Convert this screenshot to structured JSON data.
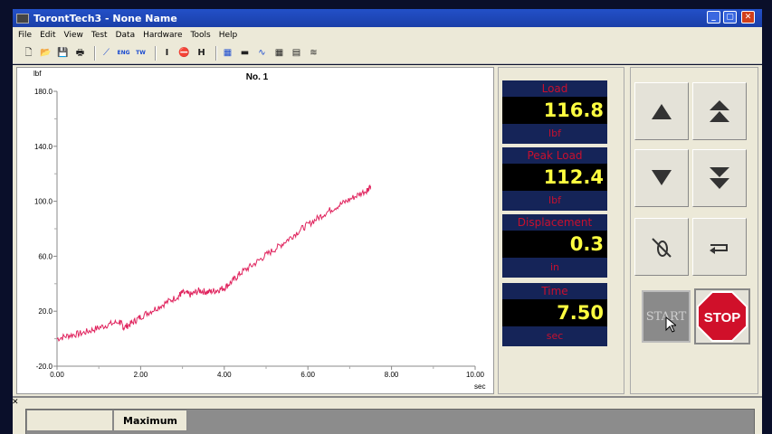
{
  "window": {
    "title": "TorontTech3 - None Name"
  },
  "menu": [
    "File",
    "Edit",
    "View",
    "Test",
    "Data",
    "Hardware",
    "Tools",
    "Help"
  ],
  "toolbar": {
    "icons": [
      "new-file-icon",
      "open-folder-icon",
      "save-icon",
      "print-icon",
      "chart-icon",
      "eng-units-icon",
      "tw-icon",
      "grip-icon",
      "stop-sign-icon",
      "fixture-icon",
      "keypad-icon",
      "data-icon",
      "curve-icon",
      "table-grid-icon",
      "report-icon",
      "settings-icon"
    ],
    "eng_label": "ENG",
    "tw_label": "TW"
  },
  "chart": {
    "title": "No. 1",
    "y_unit": "lbf",
    "x_unit": "sec"
  },
  "chart_data": {
    "type": "line",
    "title": "No. 1",
    "xlabel": "sec",
    "ylabel": "lbf",
    "xlim": [
      0,
      10
    ],
    "ylim": [
      -20,
      180
    ],
    "x_ticks": [
      "0.00",
      "2.00",
      "4.00",
      "6.00",
      "8.00",
      "10.00"
    ],
    "y_ticks": [
      "180.0",
      "140.0",
      "100.0",
      "60.0",
      "20.0",
      "-20.0"
    ],
    "series": [
      {
        "color": "#e0245e",
        "x": [
          0.0,
          0.3,
          0.6,
          0.9,
          1.2,
          1.5,
          1.6,
          1.8,
          2.0,
          2.3,
          2.6,
          2.9,
          3.0,
          3.2,
          3.4,
          3.6,
          3.8,
          4.0,
          4.2,
          4.4,
          4.7,
          5.0,
          5.3,
          5.6,
          5.9,
          6.2,
          6.5,
          6.8,
          7.1,
          7.4,
          7.5
        ],
        "y": [
          0.0,
          2.5,
          4.0,
          7.0,
          10.0,
          12.5,
          8.0,
          11.5,
          16.0,
          21.0,
          26.0,
          31.0,
          33.5,
          32.0,
          35.0,
          34.0,
          35.0,
          37.0,
          42.0,
          48.0,
          54.0,
          61.0,
          67.0,
          74.0,
          81.0,
          87.0,
          93.0,
          98.0,
          103.0,
          108.0,
          111.0
        ]
      }
    ]
  },
  "readouts": [
    {
      "label": "Load",
      "value": "116.8",
      "unit": "lbf"
    },
    {
      "label": "Peak Load",
      "value": "112.4",
      "unit": "lbf"
    },
    {
      "label": "Displacement",
      "value": "0.3",
      "unit": "in"
    },
    {
      "label": "Time",
      "value": "7.50",
      "unit": "sec"
    }
  ],
  "controls": {
    "start_label": "START",
    "stop_label": "STOP"
  },
  "results_table": {
    "column_header": "Maximum"
  },
  "colors": {
    "readout_label": "#c8102e",
    "readout_value": "#ffff40",
    "curve": "#e0245e",
    "stop_sign": "#d0102a"
  }
}
